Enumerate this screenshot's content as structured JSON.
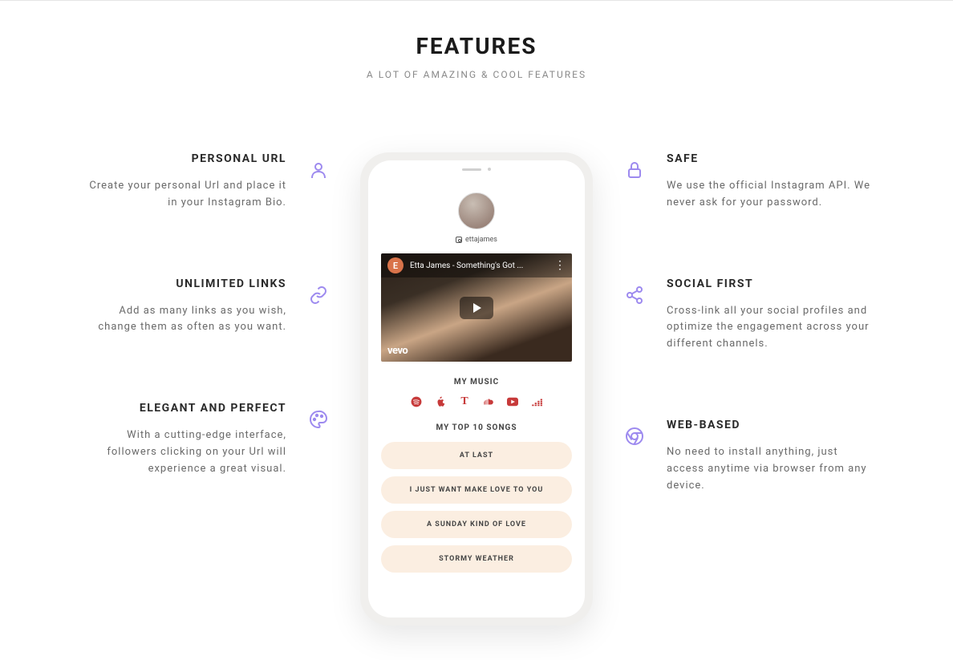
{
  "header": {
    "title": "FEATURES",
    "subtitle": "A LOT OF AMAZING & COOL FEATURES"
  },
  "features_left": [
    {
      "title": "PERSONAL URL",
      "desc": "Create your personal Url and place it in your Instagram Bio.",
      "icon": "user"
    },
    {
      "title": "UNLIMITED LINKS",
      "desc": "Add as many links as you wish, change them as often as you want.",
      "icon": "link"
    },
    {
      "title": "ELEGANT AND PERFECT",
      "desc": "With a cutting-edge interface, followers clicking on your Url will experience a great visual.",
      "icon": "palette"
    }
  ],
  "features_right": [
    {
      "title": "SAFE",
      "desc": "We use the official Instagram API. We never ask for your password.",
      "icon": "lock"
    },
    {
      "title": "SOCIAL FIRST",
      "desc": "Cross-link all your social profiles and optimize the engagement across your different channels.",
      "icon": "share"
    },
    {
      "title": "WEB-BASED",
      "desc": "No need to install anything, just access anytime via browser from any device.",
      "icon": "chrome"
    }
  ],
  "phone": {
    "username": "ettajames",
    "video_badge": "E",
    "video_title": "Etta James - Something's Got ...",
    "video_logo": "vevo",
    "music_section": "MY MUSIC",
    "songs_section": "MY TOP 10 SONGS",
    "music_services": [
      "spotify",
      "apple",
      "tidal",
      "soundcloud",
      "youtube",
      "deezer"
    ],
    "songs": [
      "AT LAST",
      "I JUST WANT MAKE LOVE TO YOU",
      "A SUNDAY KIND OF LOVE",
      "STORMY WEATHER"
    ]
  }
}
